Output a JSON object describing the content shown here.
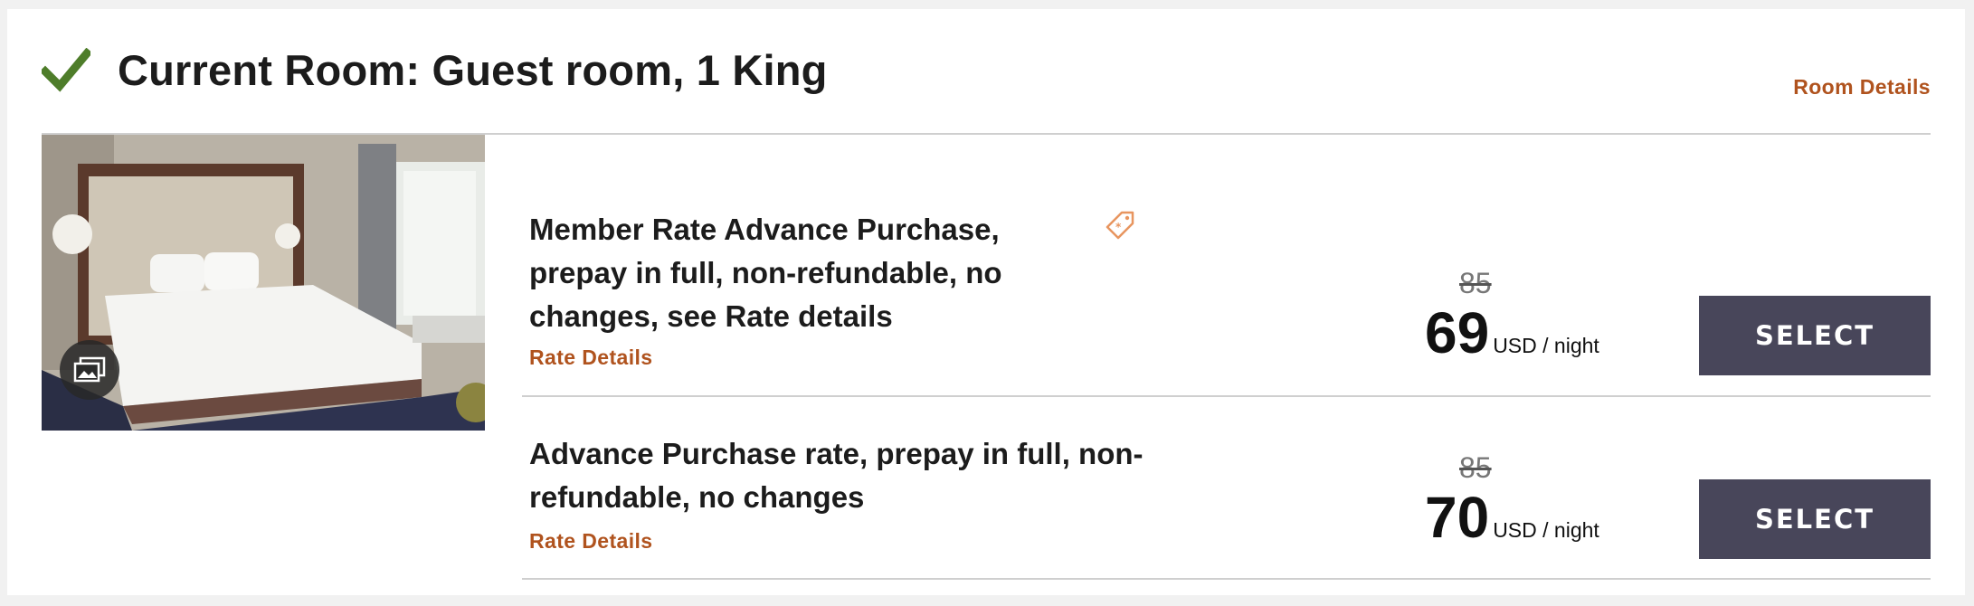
{
  "header": {
    "title": "Current Room: Guest room, 1 King",
    "room_details_link": "Room Details"
  },
  "icons": {
    "check": "check-icon",
    "gallery": "photo-gallery-icon",
    "tag": "member-rate-tag-icon"
  },
  "colors": {
    "accent_link": "#b0531e",
    "check_green": "#4e7d2a",
    "button_bg": "#48465a",
    "tag_orange": "#e8955f"
  },
  "rates": [
    {
      "name": "Member Rate Advance Purchase, prepay in full, non-refundable, no changes, see Rate details",
      "details_link": "Rate Details",
      "original_price": "85",
      "price": "69",
      "unit": "USD / night",
      "button": "SELECT"
    },
    {
      "name": "Advance Purchase rate, prepay in full, non-refundable, no changes",
      "details_link": "Rate Details",
      "original_price": "85",
      "price": "70",
      "unit": "USD / night",
      "button": "SELECT"
    }
  ]
}
